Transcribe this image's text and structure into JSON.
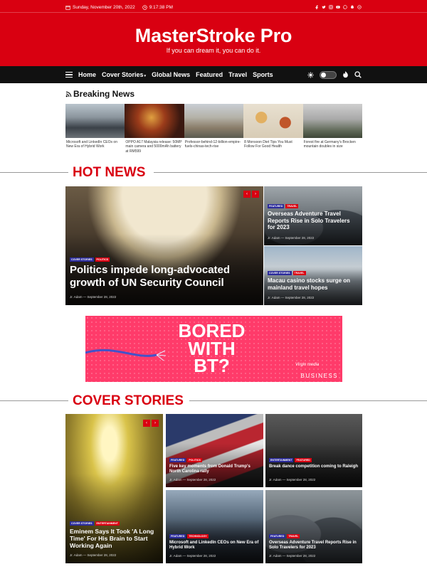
{
  "topbar": {
    "date": "Sunday, November 20th, 2022",
    "time": "9:17:38 PM",
    "social_icons": [
      "facebook-icon",
      "twitter-icon",
      "instagram-icon",
      "youtube-icon",
      "whatsapp-icon",
      "snapchat-icon",
      "wordpress-icon"
    ]
  },
  "brand": {
    "name": "MasterStroke Pro",
    "tagline": "If you can dream it, you can do it."
  },
  "nav": {
    "items": [
      "Home",
      "Cover Stories",
      "Global News",
      "Featured",
      "Travel",
      "Sports"
    ]
  },
  "breaking": {
    "title": "Breaking News",
    "items": [
      {
        "caption": "Microsoft and LinkedIn CEOs on New Era of Hybrid Work"
      },
      {
        "caption": "OPPO A17 Malaysia release: 50MP main camera and 5000mAh battery at RM599"
      },
      {
        "caption": "Professor-behind-12-billion-empire-fuels-chinas-tech-rise"
      },
      {
        "caption": "8 Monsoon Diet Tips You Must Follow For Good Health"
      },
      {
        "caption": "Forest fire at Germany's Brocken mountain doubles in size"
      }
    ]
  },
  "hot_news": {
    "heading": "HOT NEWS",
    "main": {
      "tags": [
        "COVER STORIES",
        "POLITICS"
      ],
      "title": "Politics impede long-advocated growth of UN Security Council",
      "author": "Jr. Adam",
      "date": "September 28, 2022"
    },
    "side": [
      {
        "tags": [
          "FEATURED",
          "TRAVEL"
        ],
        "title": "Overseas Adventure Travel Reports Rise in Solo Travelers for 2023",
        "author": "Jr. Adam",
        "date": "September 28, 2022"
      },
      {
        "tags": [
          "COVER STORIES",
          "TRAVEL"
        ],
        "title": "Macau casino stocks surge on mainland travel hopes",
        "author": "Jr. Adam",
        "date": "September 28, 2022"
      }
    ]
  },
  "ad": {
    "headline": "BORED WITH BT?",
    "brand": "Virgin media",
    "sub": "BUSINESS"
  },
  "cover_stories": {
    "heading": "COVER STORIES",
    "main": {
      "tags": [
        "COVER STORIES",
        "ENTERTAINMENT"
      ],
      "title": "Eminem Says It Took 'A Long Time' For His Brain to Start Working Again",
      "author": "Jr. Adam",
      "date": "September 28, 2022"
    },
    "grid": [
      {
        "tags": [
          "FEATURED",
          "POLITICS"
        ],
        "title": "Five key moments from Donald Trump's North Carolina rally",
        "author": "Jr. Adam",
        "date": "September 28, 2022"
      },
      {
        "tags": [
          "ENTERTAINMENT",
          "FEATURED"
        ],
        "title": "Break dance competition coming to Raleigh",
        "author": "Jr. Adam",
        "date": "September 28, 2022"
      },
      {
        "tags": [
          "FEATURED",
          "TECHNOLOGY"
        ],
        "title": "Microsoft and LinkedIn CEOs on New Era of Hybrid Work",
        "author": "Jr. Adam",
        "date": "September 28, 2022"
      },
      {
        "tags": [
          "FEATURED",
          "TRAVEL"
        ],
        "title": "Overseas Adventure Travel Reports Rise in Solo Travelers for 2023",
        "author": "Jr. Adam",
        "date": "September 28, 2022"
      }
    ]
  }
}
